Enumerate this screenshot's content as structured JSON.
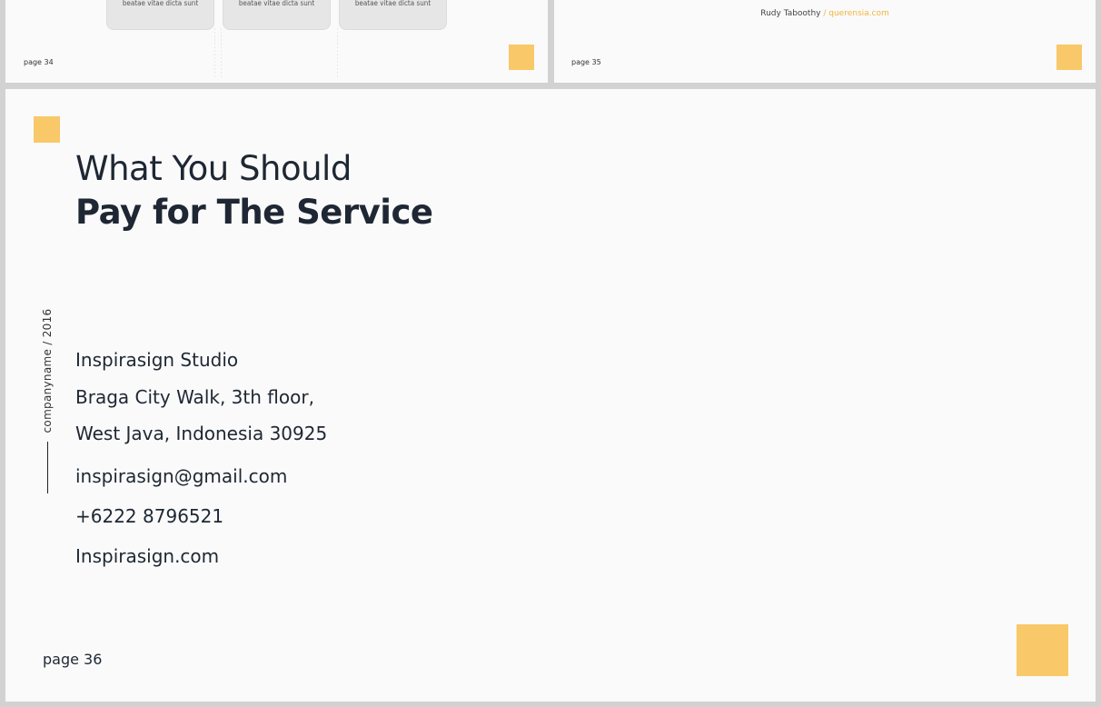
{
  "thumbnails": {
    "left": {
      "cards": [
        {
          "text": "beatae vitae dicta sunt"
        },
        {
          "text": "beatae vitae dicta sunt"
        },
        {
          "text": "beatae vitae dicta sunt"
        }
      ],
      "page": "page 34"
    },
    "right": {
      "author_name": "Rudy Taboothy",
      "author_sep": " / ",
      "author_link": "querensia.com",
      "page": "page 35"
    }
  },
  "slide": {
    "title_line1": "What You Should",
    "title_line2": "Pay for The Service",
    "side_label": "companyname  /  2016",
    "company": "Inspirasign Studio",
    "address1": "Braga City Walk, 3th floor,",
    "address2": "West Java, Indonesia 30925",
    "email": "inspirasign@gmail.com",
    "phone": "+6222 8796521",
    "website": "Inspirasign.com",
    "page": "page 36"
  },
  "colors": {
    "accent": "#f8c869",
    "text": "#1e2733",
    "background": "#fafafa"
  }
}
